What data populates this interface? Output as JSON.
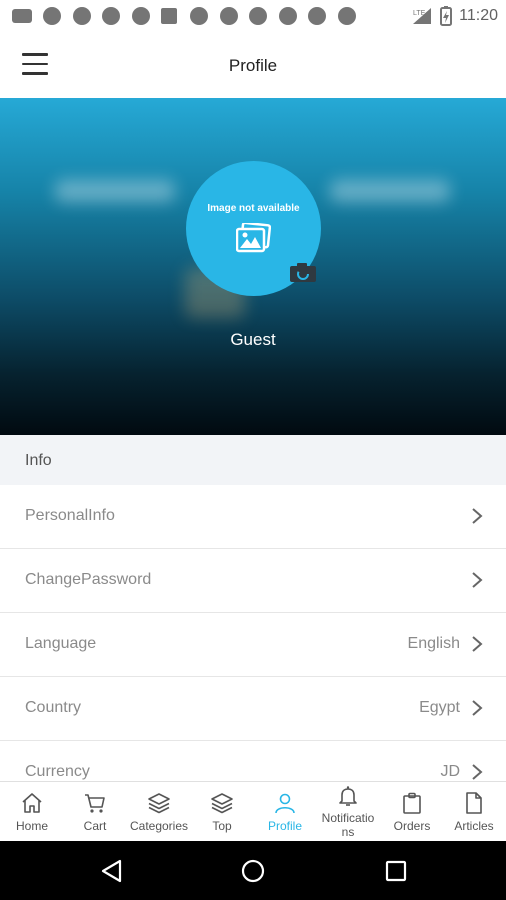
{
  "status_bar": {
    "time": "11:20",
    "network": "LTE"
  },
  "app_bar": {
    "title": "Profile",
    "menu_icon": "hamburger-menu-icon"
  },
  "profile": {
    "image_placeholder_text": "Image not available",
    "username": "Guest",
    "camera_icon": "camera-icon"
  },
  "info_section": {
    "header": "Info",
    "items": [
      {
        "label": "PersonalInfo",
        "value": ""
      },
      {
        "label": "ChangePassword",
        "value": ""
      },
      {
        "label": "Language",
        "value": "English"
      },
      {
        "label": "Country",
        "value": "Egypt"
      },
      {
        "label": "Currency",
        "value": "JD"
      }
    ]
  },
  "bottom_nav": {
    "items": [
      {
        "label": "Home",
        "icon": "home-icon"
      },
      {
        "label": "Cart",
        "icon": "cart-icon"
      },
      {
        "label": "Categories",
        "icon": "layers-icon"
      },
      {
        "label": "Top",
        "icon": "layers-icon"
      },
      {
        "label": "Profile",
        "icon": "person-icon"
      },
      {
        "label": "Notifications",
        "icon": "bell-icon"
      },
      {
        "label": "Orders",
        "icon": "clipboard-icon"
      },
      {
        "label": "Articles",
        "icon": "document-icon"
      }
    ],
    "active_index": 4,
    "active_color": "#29b6e6"
  },
  "system_nav": {
    "back": "back-icon",
    "home": "home-circle-icon",
    "recents": "recents-icon"
  }
}
